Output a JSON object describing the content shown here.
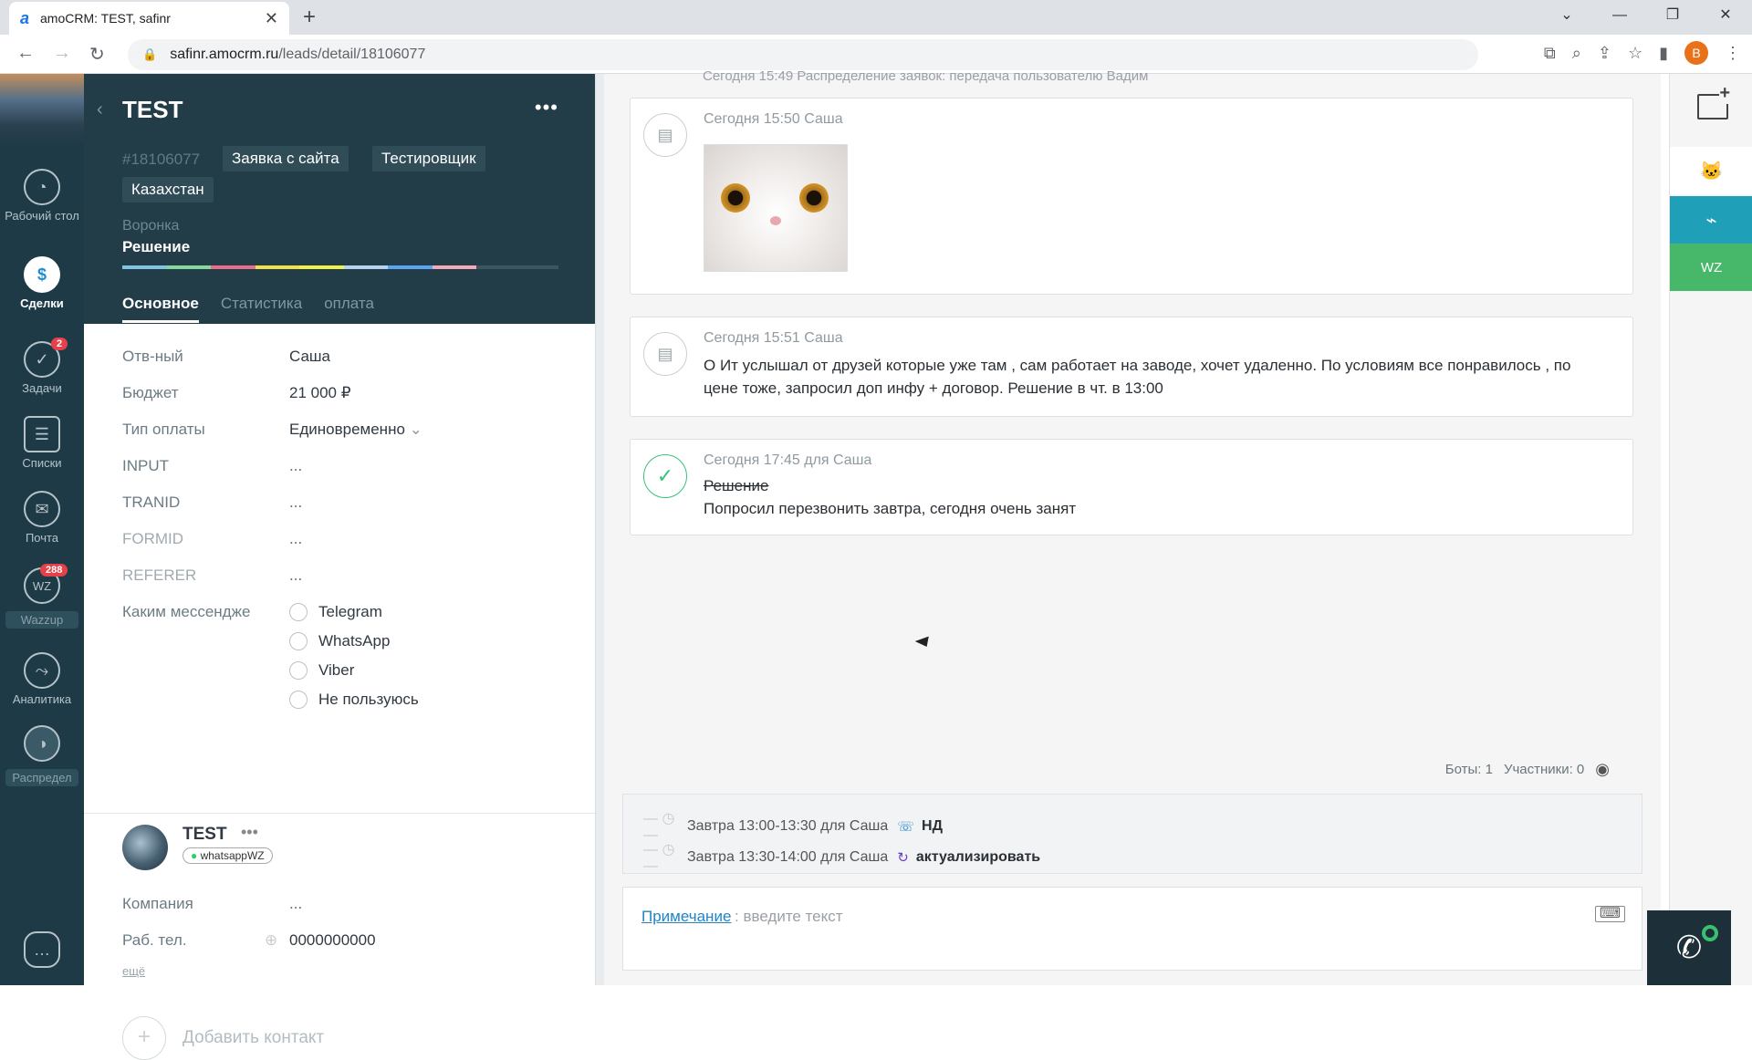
{
  "browser": {
    "tab_title": "amoCRM: TEST, safinr",
    "url_host": "safinr.amocrm.ru",
    "url_path": "/leads/detail/18106077",
    "profile_letter": "B"
  },
  "leftnav": {
    "items": [
      {
        "label": "Рабочий стол",
        "icon": "dashboard-icon"
      },
      {
        "label": "Сделки",
        "icon": "deals-icon"
      },
      {
        "label": "Задачи",
        "icon": "tasks-icon",
        "badge": "2"
      },
      {
        "label": "Списки",
        "icon": "lists-icon"
      },
      {
        "label": "Почта",
        "icon": "mail-icon"
      },
      {
        "label": "Wazzup",
        "icon": "wazzup-icon",
        "badge": "288",
        "tag_text": "WZ"
      },
      {
        "label": "Аналитика",
        "icon": "analytics-icon"
      },
      {
        "label": "Распредел",
        "icon": "distribution-icon"
      }
    ]
  },
  "lead": {
    "title": "TEST",
    "id": "#18106077",
    "tags": [
      "Заявка с сайта",
      "Тестировщик",
      "Казахстан"
    ],
    "pipeline_label": "Воронка",
    "pipeline_stage": "Решение",
    "tabs": [
      "Основное",
      "Статистика",
      "оплата"
    ],
    "progress_colors": [
      "#7fc4e0",
      "#86d7a0",
      "#e86e8c",
      "#f0e04c",
      "#f2f04a",
      "#b4d4ef",
      "#5aa4f0",
      "#f3a9b8"
    ],
    "fields": [
      {
        "label": "Отв-ный",
        "value": "Саша"
      },
      {
        "label": "Бюджет",
        "value": "21 000 ₽"
      },
      {
        "label": "Тип оплаты",
        "value": "Единовременно"
      },
      {
        "label": "INPUT",
        "value": "..."
      },
      {
        "label": "TRANID",
        "value": "..."
      },
      {
        "label": "FORMID",
        "value": "..."
      },
      {
        "label": "REFERER",
        "value": "..."
      },
      {
        "label": "Каким мессендже",
        "value": ""
      }
    ],
    "messenger_options": [
      "Telegram",
      "WhatsApp",
      "Viber",
      "Не пользуюсь"
    ],
    "contact": {
      "name": "TEST",
      "channel": "whatsappWZ",
      "fields": [
        {
          "label": "Компания",
          "value": "..."
        },
        {
          "label": "Раб. тел.",
          "value": "0000000000"
        }
      ],
      "more_link": "ещё",
      "add_label": "Добавить контакт"
    }
  },
  "feed": {
    "cut_text": "Сегодня 15:49 Распределение заявок: передача пользователю Вадим",
    "notes": [
      {
        "meta": "Сегодня 15:50 Саша",
        "type": "image",
        "image": "cat-photo"
      },
      {
        "meta": "Сегодня 15:51 Саша",
        "type": "text",
        "text": "О Ит услышал от друзей которые уже там , сам работает на заводе, хочет удаленно. По условиям все понравилось , по цене тоже, запросил доп инфу + договор. Решение в чт. в 13:00"
      },
      {
        "meta": "Сегодня 17:45  для Саша",
        "type": "task-done",
        "title": "Решение",
        "text": "Попросил перезвонить завтра, сегодня очень занят"
      }
    ],
    "stats": {
      "bots": "Боты: 1",
      "participants": "Участники: 0"
    },
    "tasks": [
      {
        "time": "Завтра 13:00-13:30 для Саша",
        "title": "НД",
        "icon": "phone-icon"
      },
      {
        "time": "Завтра 13:30-14:00 для Саша",
        "title": "актуализировать",
        "icon": "refresh-icon"
      }
    ],
    "note_input": {
      "link": "Примечание",
      "placeholder": ": введите текст"
    }
  },
  "rightbar": {
    "buttons": [
      {
        "name": "widget-cat",
        "icon": "cat-icon",
        "color": "#ffffff"
      },
      {
        "name": "widget-pulse",
        "icon": "pulse-icon",
        "color": "#1fa0b8"
      },
      {
        "name": "widget-wz",
        "icon": "wz-icon",
        "label": "WZ",
        "color": "#47b86a"
      }
    ]
  }
}
